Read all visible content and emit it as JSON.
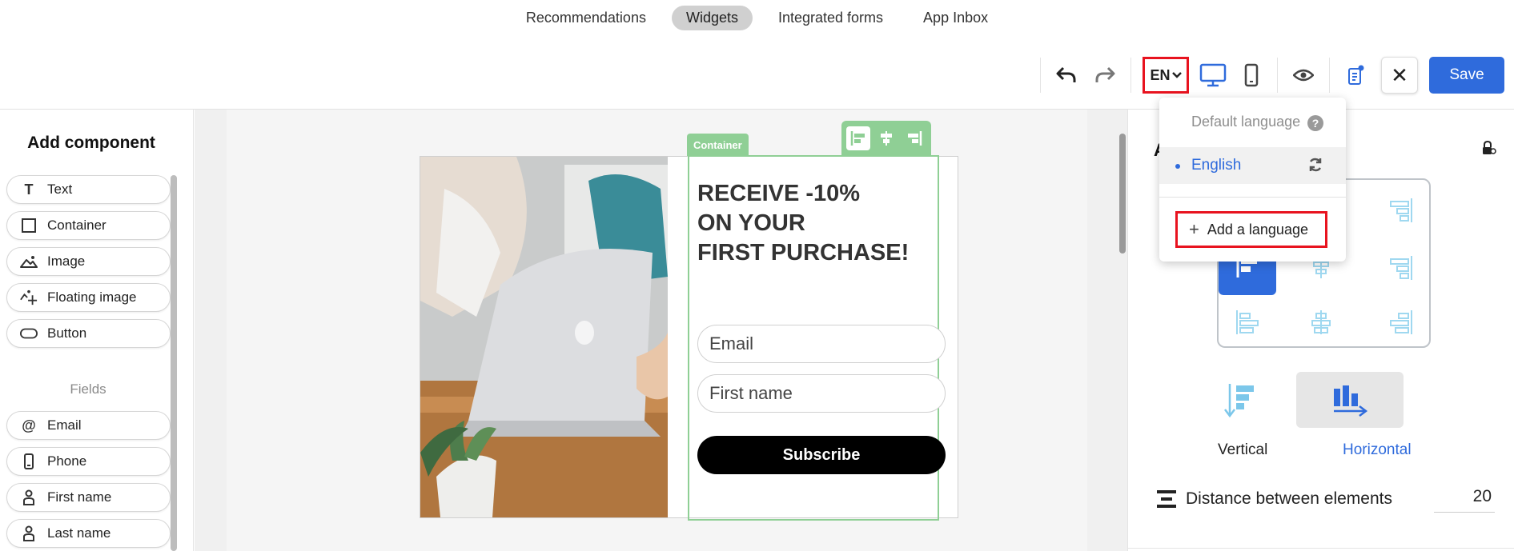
{
  "topnav": {
    "tabs": [
      {
        "label": "Recommendations"
      },
      {
        "label": "Widgets"
      },
      {
        "label": "Integrated forms"
      },
      {
        "label": "App Inbox"
      }
    ]
  },
  "toolbar": {
    "lang_code": "EN",
    "save_label": "Save",
    "close_glyph": "✕"
  },
  "left_panel": {
    "title": "Add component",
    "components": [
      {
        "label": "Text",
        "icon": "text-icon"
      },
      {
        "label": "Container",
        "icon": "container-icon"
      },
      {
        "label": "Image",
        "icon": "image-icon"
      },
      {
        "label": "Floating image",
        "icon": "floating-image-icon"
      },
      {
        "label": "Button",
        "icon": "button-icon"
      }
    ],
    "fields_label": "Fields",
    "fields": [
      {
        "label": "Email",
        "icon": "at-icon"
      },
      {
        "label": "Phone",
        "icon": "phone-icon"
      },
      {
        "label": "First name",
        "icon": "person-icon"
      },
      {
        "label": "Last name",
        "icon": "person-icon"
      }
    ]
  },
  "canvas": {
    "container_tag": "Container",
    "headline": [
      "RECEIVE -10%",
      "ON YOUR",
      "FIRST PURCHASE!"
    ],
    "email_placeholder": "Email",
    "firstname_placeholder": "First name",
    "subscribe_label": "Subscribe"
  },
  "right_panel": {
    "title_initial": "A",
    "direction": {
      "vertical_label": "Vertical",
      "horizontal_label": "Horizontal",
      "selected": "Horizontal"
    },
    "distance_label": "Distance between elements",
    "distance_value": "20"
  },
  "language_dropdown": {
    "header": "Default language",
    "languages": [
      {
        "label": "English",
        "selected": true
      }
    ],
    "add_label": "Add a language"
  },
  "colors": {
    "accent": "#2f6bdc",
    "highlight": "#e8131f",
    "container_outline": "#8fcf95"
  }
}
